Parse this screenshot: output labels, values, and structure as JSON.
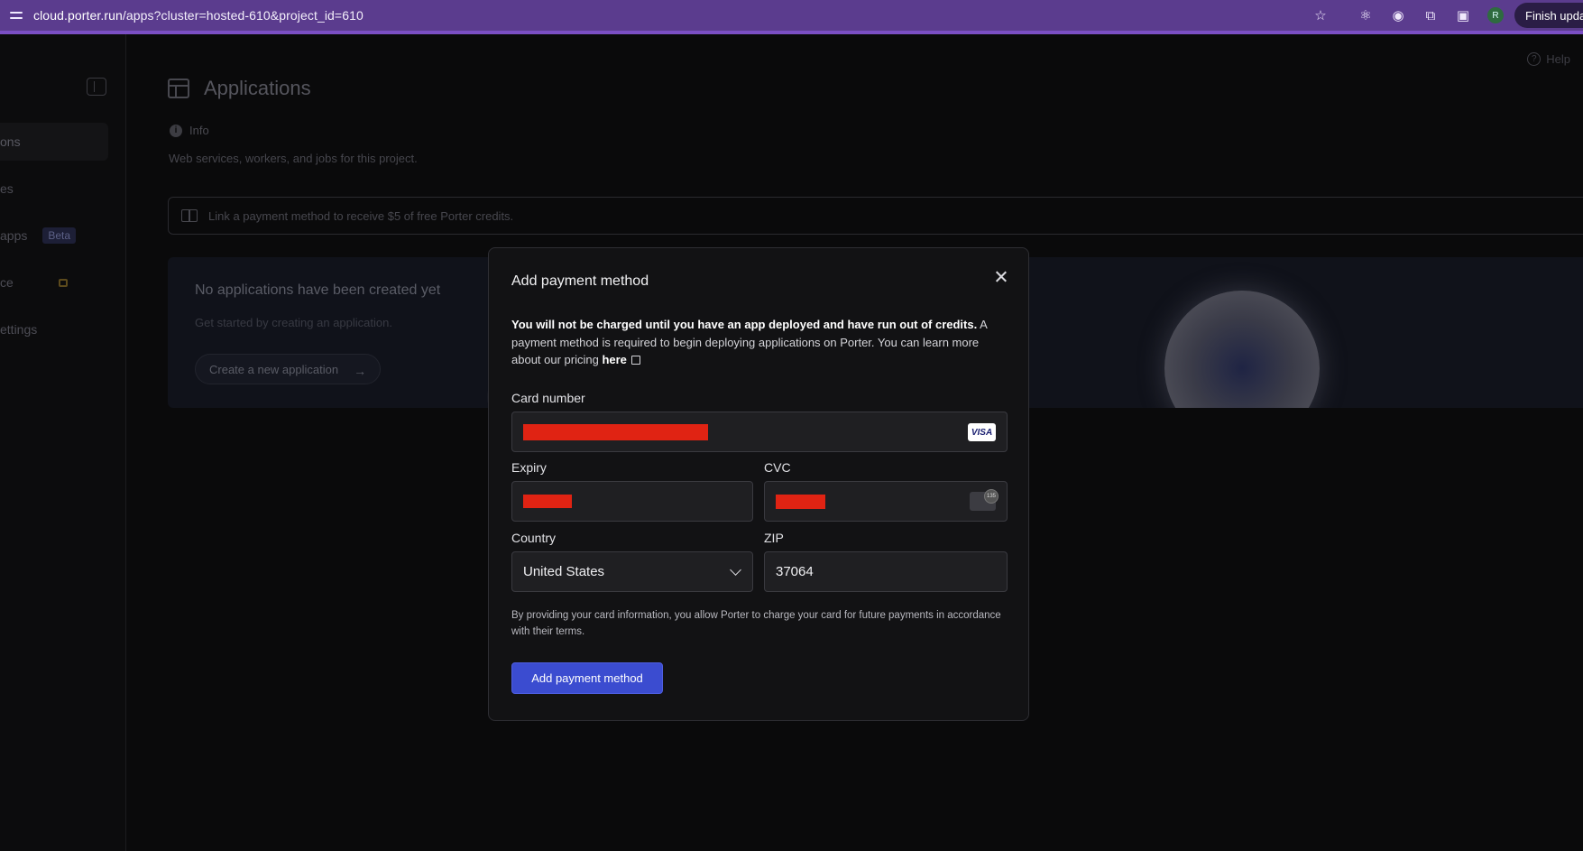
{
  "browser": {
    "url_host": "cloud.porter.run",
    "url_path": "/apps?cluster=hosted-610&project_id=610",
    "profile_initial": "R",
    "finish_update_label": "Finish upda"
  },
  "sidebar": {
    "items": [
      {
        "label": "ons"
      },
      {
        "label": "es"
      },
      {
        "label": "apps",
        "badge": "Beta"
      },
      {
        "label": "ce"
      },
      {
        "label": "ettings"
      }
    ]
  },
  "header": {
    "help_label": "Help",
    "title": "Applications",
    "info_label": "Info",
    "subtitle": "Web services, workers, and jobs for this project."
  },
  "promo": {
    "text": "Link a payment method to receive $5 of free Porter credits."
  },
  "empty_state": {
    "title": "No applications have been created yet",
    "subtitle": "Get started by creating an application.",
    "button_label": "Create a new application"
  },
  "modal": {
    "title": "Add payment method",
    "notice_bold": "You will not be charged until you have an app deployed and have run out of credits.",
    "notice_rest": " A payment method is required to begin deploying applications on Porter. You can learn more about our pricing ",
    "notice_link": "here",
    "card_number_label": "Card number",
    "card_brand": "VISA",
    "expiry_label": "Expiry",
    "cvc_label": "CVC",
    "country_label": "Country",
    "country_value": "United States",
    "zip_label": "ZIP",
    "zip_value": "37064",
    "terms": "By providing your card information, you allow Porter to charge your card for future payments in accordance with their terms.",
    "submit_label": "Add payment method"
  }
}
